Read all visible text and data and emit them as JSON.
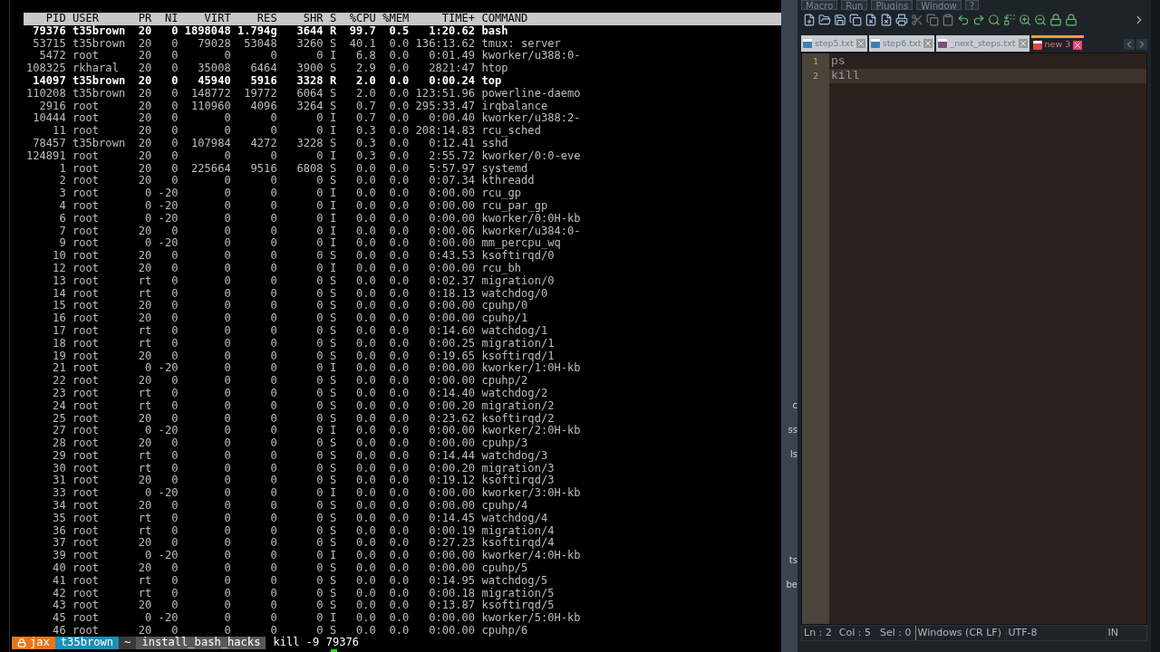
{
  "terminal": {
    "header": {
      "pid": "PID",
      "user": "USER",
      "pr": "PR",
      "ni": "NI",
      "virt": "VIRT",
      "res": "RES",
      "shr": "SHR",
      "s": "S",
      "cpu": "%CPU",
      "mem": "%MEM",
      "time": "TIME+",
      "command": "COMMAND"
    },
    "processes": [
      {
        "pid": "79376",
        "user": "t35brown",
        "pr": "20",
        "ni": "0",
        "virt": "1898048",
        "res": "1.794g",
        "shr": "3644",
        "s": "R",
        "cpu": "99.7",
        "mem": "0.5",
        "time": "1:20.62",
        "command": "bash",
        "bright": true
      },
      {
        "pid": "53715",
        "user": "t35brown",
        "pr": "20",
        "ni": "0",
        "virt": "79028",
        "res": "53048",
        "shr": "3260",
        "s": "S",
        "cpu": "40.1",
        "mem": "0.0",
        "time": "136:13.62",
        "command": "tmux: server",
        "bright": false
      },
      {
        "pid": "5472",
        "user": "root",
        "pr": "20",
        "ni": "0",
        "virt": "0",
        "res": "0",
        "shr": "0",
        "s": "I",
        "cpu": "6.8",
        "mem": "0.0",
        "time": "0:01.49",
        "command": "kworker/u388:0-",
        "bright": false
      },
      {
        "pid": "108325",
        "user": "rkharal",
        "pr": "20",
        "ni": "0",
        "virt": "35008",
        "res": "6464",
        "shr": "3900",
        "s": "S",
        "cpu": "2.9",
        "mem": "0.0",
        "time": "2821:47",
        "command": "htop",
        "bright": false
      },
      {
        "pid": "14097",
        "user": "t35brown",
        "pr": "20",
        "ni": "0",
        "virt": "45940",
        "res": "5916",
        "shr": "3328",
        "s": "R",
        "cpu": "2.0",
        "mem": "0.0",
        "time": "0:00.24",
        "command": "top",
        "bright": true
      },
      {
        "pid": "110208",
        "user": "t35brown",
        "pr": "20",
        "ni": "0",
        "virt": "148772",
        "res": "19772",
        "shr": "6064",
        "s": "S",
        "cpu": "2.0",
        "mem": "0.0",
        "time": "123:51.96",
        "command": "powerline-daemo",
        "bright": false
      },
      {
        "pid": "2916",
        "user": "root",
        "pr": "20",
        "ni": "0",
        "virt": "110960",
        "res": "4096",
        "shr": "3264",
        "s": "S",
        "cpu": "0.7",
        "mem": "0.0",
        "time": "295:33.47",
        "command": "irqbalance",
        "bright": false
      },
      {
        "pid": "10444",
        "user": "root",
        "pr": "20",
        "ni": "0",
        "virt": "0",
        "res": "0",
        "shr": "0",
        "s": "I",
        "cpu": "0.7",
        "mem": "0.0",
        "time": "0:00.40",
        "command": "kworker/u388:2-",
        "bright": false
      },
      {
        "pid": "11",
        "user": "root",
        "pr": "20",
        "ni": "0",
        "virt": "0",
        "res": "0",
        "shr": "0",
        "s": "I",
        "cpu": "0.3",
        "mem": "0.0",
        "time": "208:14.83",
        "command": "rcu_sched",
        "bright": false
      },
      {
        "pid": "78457",
        "user": "t35brown",
        "pr": "20",
        "ni": "0",
        "virt": "107984",
        "res": "4272",
        "shr": "3228",
        "s": "S",
        "cpu": "0.3",
        "mem": "0.0",
        "time": "0:12.41",
        "command": "sshd",
        "bright": false
      },
      {
        "pid": "124891",
        "user": "root",
        "pr": "20",
        "ni": "0",
        "virt": "0",
        "res": "0",
        "shr": "0",
        "s": "I",
        "cpu": "0.3",
        "mem": "0.0",
        "time": "2:55.72",
        "command": "kworker/0:0-eve",
        "bright": false
      },
      {
        "pid": "1",
        "user": "root",
        "pr": "20",
        "ni": "0",
        "virt": "225664",
        "res": "9516",
        "shr": "6808",
        "s": "S",
        "cpu": "0.0",
        "mem": "0.0",
        "time": "5:57.97",
        "command": "systemd",
        "bright": false
      },
      {
        "pid": "2",
        "user": "root",
        "pr": "20",
        "ni": "0",
        "virt": "0",
        "res": "0",
        "shr": "0",
        "s": "S",
        "cpu": "0.0",
        "mem": "0.0",
        "time": "0:07.34",
        "command": "kthreadd",
        "bright": false
      },
      {
        "pid": "3",
        "user": "root",
        "pr": "0",
        "ni": "-20",
        "virt": "0",
        "res": "0",
        "shr": "0",
        "s": "I",
        "cpu": "0.0",
        "mem": "0.0",
        "time": "0:00.00",
        "command": "rcu_gp",
        "bright": false
      },
      {
        "pid": "4",
        "user": "root",
        "pr": "0",
        "ni": "-20",
        "virt": "0",
        "res": "0",
        "shr": "0",
        "s": "I",
        "cpu": "0.0",
        "mem": "0.0",
        "time": "0:00.00",
        "command": "rcu_par_gp",
        "bright": false
      },
      {
        "pid": "6",
        "user": "root",
        "pr": "0",
        "ni": "-20",
        "virt": "0",
        "res": "0",
        "shr": "0",
        "s": "I",
        "cpu": "0.0",
        "mem": "0.0",
        "time": "0:00.00",
        "command": "kworker/0:0H-kb",
        "bright": false
      },
      {
        "pid": "7",
        "user": "root",
        "pr": "20",
        "ni": "0",
        "virt": "0",
        "res": "0",
        "shr": "0",
        "s": "I",
        "cpu": "0.0",
        "mem": "0.0",
        "time": "0:00.06",
        "command": "kworker/u384:0-",
        "bright": false
      },
      {
        "pid": "9",
        "user": "root",
        "pr": "0",
        "ni": "-20",
        "virt": "0",
        "res": "0",
        "shr": "0",
        "s": "I",
        "cpu": "0.0",
        "mem": "0.0",
        "time": "0:00.00",
        "command": "mm_percpu_wq",
        "bright": false
      },
      {
        "pid": "10",
        "user": "root",
        "pr": "20",
        "ni": "0",
        "virt": "0",
        "res": "0",
        "shr": "0",
        "s": "S",
        "cpu": "0.0",
        "mem": "0.0",
        "time": "0:43.53",
        "command": "ksoftirqd/0",
        "bright": false
      },
      {
        "pid": "12",
        "user": "root",
        "pr": "20",
        "ni": "0",
        "virt": "0",
        "res": "0",
        "shr": "0",
        "s": "I",
        "cpu": "0.0",
        "mem": "0.0",
        "time": "0:00.00",
        "command": "rcu_bh",
        "bright": false
      },
      {
        "pid": "13",
        "user": "root",
        "pr": "rt",
        "ni": "0",
        "virt": "0",
        "res": "0",
        "shr": "0",
        "s": "S",
        "cpu": "0.0",
        "mem": "0.0",
        "time": "0:02.37",
        "command": "migration/0",
        "bright": false
      },
      {
        "pid": "14",
        "user": "root",
        "pr": "rt",
        "ni": "0",
        "virt": "0",
        "res": "0",
        "shr": "0",
        "s": "S",
        "cpu": "0.0",
        "mem": "0.0",
        "time": "0:18.13",
        "command": "watchdog/0",
        "bright": false
      },
      {
        "pid": "15",
        "user": "root",
        "pr": "20",
        "ni": "0",
        "virt": "0",
        "res": "0",
        "shr": "0",
        "s": "S",
        "cpu": "0.0",
        "mem": "0.0",
        "time": "0:00.00",
        "command": "cpuhp/0",
        "bright": false
      },
      {
        "pid": "16",
        "user": "root",
        "pr": "20",
        "ni": "0",
        "virt": "0",
        "res": "0",
        "shr": "0",
        "s": "S",
        "cpu": "0.0",
        "mem": "0.0",
        "time": "0:00.00",
        "command": "cpuhp/1",
        "bright": false
      },
      {
        "pid": "17",
        "user": "root",
        "pr": "rt",
        "ni": "0",
        "virt": "0",
        "res": "0",
        "shr": "0",
        "s": "S",
        "cpu": "0.0",
        "mem": "0.0",
        "time": "0:14.60",
        "command": "watchdog/1",
        "bright": false
      },
      {
        "pid": "18",
        "user": "root",
        "pr": "rt",
        "ni": "0",
        "virt": "0",
        "res": "0",
        "shr": "0",
        "s": "S",
        "cpu": "0.0",
        "mem": "0.0",
        "time": "0:00.25",
        "command": "migration/1",
        "bright": false
      },
      {
        "pid": "19",
        "user": "root",
        "pr": "20",
        "ni": "0",
        "virt": "0",
        "res": "0",
        "shr": "0",
        "s": "S",
        "cpu": "0.0",
        "mem": "0.0",
        "time": "0:19.65",
        "command": "ksoftirqd/1",
        "bright": false
      },
      {
        "pid": "21",
        "user": "root",
        "pr": "0",
        "ni": "-20",
        "virt": "0",
        "res": "0",
        "shr": "0",
        "s": "I",
        "cpu": "0.0",
        "mem": "0.0",
        "time": "0:00.00",
        "command": "kworker/1:0H-kb",
        "bright": false
      },
      {
        "pid": "22",
        "user": "root",
        "pr": "20",
        "ni": "0",
        "virt": "0",
        "res": "0",
        "shr": "0",
        "s": "S",
        "cpu": "0.0",
        "mem": "0.0",
        "time": "0:00.00",
        "command": "cpuhp/2",
        "bright": false
      },
      {
        "pid": "23",
        "user": "root",
        "pr": "rt",
        "ni": "0",
        "virt": "0",
        "res": "0",
        "shr": "0",
        "s": "S",
        "cpu": "0.0",
        "mem": "0.0",
        "time": "0:14.40",
        "command": "watchdog/2",
        "bright": false
      },
      {
        "pid": "24",
        "user": "root",
        "pr": "rt",
        "ni": "0",
        "virt": "0",
        "res": "0",
        "shr": "0",
        "s": "S",
        "cpu": "0.0",
        "mem": "0.0",
        "time": "0:00.20",
        "command": "migration/2",
        "bright": false
      },
      {
        "pid": "25",
        "user": "root",
        "pr": "20",
        "ni": "0",
        "virt": "0",
        "res": "0",
        "shr": "0",
        "s": "S",
        "cpu": "0.0",
        "mem": "0.0",
        "time": "0:23.62",
        "command": "ksoftirqd/2",
        "bright": false
      },
      {
        "pid": "27",
        "user": "root",
        "pr": "0",
        "ni": "-20",
        "virt": "0",
        "res": "0",
        "shr": "0",
        "s": "I",
        "cpu": "0.0",
        "mem": "0.0",
        "time": "0:00.00",
        "command": "kworker/2:0H-kb",
        "bright": false
      },
      {
        "pid": "28",
        "user": "root",
        "pr": "20",
        "ni": "0",
        "virt": "0",
        "res": "0",
        "shr": "0",
        "s": "S",
        "cpu": "0.0",
        "mem": "0.0",
        "time": "0:00.00",
        "command": "cpuhp/3",
        "bright": false
      },
      {
        "pid": "29",
        "user": "root",
        "pr": "rt",
        "ni": "0",
        "virt": "0",
        "res": "0",
        "shr": "0",
        "s": "S",
        "cpu": "0.0",
        "mem": "0.0",
        "time": "0:14.44",
        "command": "watchdog/3",
        "bright": false
      },
      {
        "pid": "30",
        "user": "root",
        "pr": "rt",
        "ni": "0",
        "virt": "0",
        "res": "0",
        "shr": "0",
        "s": "S",
        "cpu": "0.0",
        "mem": "0.0",
        "time": "0:00.20",
        "command": "migration/3",
        "bright": false
      },
      {
        "pid": "31",
        "user": "root",
        "pr": "20",
        "ni": "0",
        "virt": "0",
        "res": "0",
        "shr": "0",
        "s": "S",
        "cpu": "0.0",
        "mem": "0.0",
        "time": "0:19.12",
        "command": "ksoftirqd/3",
        "bright": false
      },
      {
        "pid": "33",
        "user": "root",
        "pr": "0",
        "ni": "-20",
        "virt": "0",
        "res": "0",
        "shr": "0",
        "s": "I",
        "cpu": "0.0",
        "mem": "0.0",
        "time": "0:00.00",
        "command": "kworker/3:0H-kb",
        "bright": false
      },
      {
        "pid": "34",
        "user": "root",
        "pr": "20",
        "ni": "0",
        "virt": "0",
        "res": "0",
        "shr": "0",
        "s": "S",
        "cpu": "0.0",
        "mem": "0.0",
        "time": "0:00.00",
        "command": "cpuhp/4",
        "bright": false
      },
      {
        "pid": "35",
        "user": "root",
        "pr": "rt",
        "ni": "0",
        "virt": "0",
        "res": "0",
        "shr": "0",
        "s": "S",
        "cpu": "0.0",
        "mem": "0.0",
        "time": "0:14.45",
        "command": "watchdog/4",
        "bright": false
      },
      {
        "pid": "36",
        "user": "root",
        "pr": "rt",
        "ni": "0",
        "virt": "0",
        "res": "0",
        "shr": "0",
        "s": "S",
        "cpu": "0.0",
        "mem": "0.0",
        "time": "0:00.19",
        "command": "migration/4",
        "bright": false
      },
      {
        "pid": "37",
        "user": "root",
        "pr": "20",
        "ni": "0",
        "virt": "0",
        "res": "0",
        "shr": "0",
        "s": "S",
        "cpu": "0.0",
        "mem": "0.0",
        "time": "0:27.23",
        "command": "ksoftirqd/4",
        "bright": false
      },
      {
        "pid": "39",
        "user": "root",
        "pr": "0",
        "ni": "-20",
        "virt": "0",
        "res": "0",
        "shr": "0",
        "s": "I",
        "cpu": "0.0",
        "mem": "0.0",
        "time": "0:00.00",
        "command": "kworker/4:0H-kb",
        "bright": false
      },
      {
        "pid": "40",
        "user": "root",
        "pr": "20",
        "ni": "0",
        "virt": "0",
        "res": "0",
        "shr": "0",
        "s": "S",
        "cpu": "0.0",
        "mem": "0.0",
        "time": "0:00.00",
        "command": "cpuhp/5",
        "bright": false
      },
      {
        "pid": "41",
        "user": "root",
        "pr": "rt",
        "ni": "0",
        "virt": "0",
        "res": "0",
        "shr": "0",
        "s": "S",
        "cpu": "0.0",
        "mem": "0.0",
        "time": "0:14.95",
        "command": "watchdog/5",
        "bright": false
      },
      {
        "pid": "42",
        "user": "root",
        "pr": "rt",
        "ni": "0",
        "virt": "0",
        "res": "0",
        "shr": "0",
        "s": "S",
        "cpu": "0.0",
        "mem": "0.0",
        "time": "0:00.18",
        "command": "migration/5",
        "bright": false
      },
      {
        "pid": "43",
        "user": "root",
        "pr": "20",
        "ni": "0",
        "virt": "0",
        "res": "0",
        "shr": "0",
        "s": "S",
        "cpu": "0.0",
        "mem": "0.0",
        "time": "0:13.87",
        "command": "ksoftirqd/5",
        "bright": false
      },
      {
        "pid": "45",
        "user": "root",
        "pr": "0",
        "ni": "-20",
        "virt": "0",
        "res": "0",
        "shr": "0",
        "s": "I",
        "cpu": "0.0",
        "mem": "0.0",
        "time": "0:00.00",
        "command": "kworker/5:0H-kb",
        "bright": false
      },
      {
        "pid": "46",
        "user": "root",
        "pr": "20",
        "ni": "0",
        "virt": "0",
        "res": "0",
        "shr": "0",
        "s": "S",
        "cpu": "0.0",
        "mem": "0.0",
        "time": "0:00.00",
        "command": "cpuhp/6",
        "bright": false
      }
    ],
    "prompt": {
      "segments": [
        {
          "text": "jax",
          "color": "#e8761a"
        },
        {
          "text": "t35brown",
          "color": "#1c8fb8"
        },
        {
          "text": "~",
          "color": "#3a3a3a"
        },
        {
          "text": "install_bash_hacks",
          "color": "#585858"
        }
      ],
      "command": "kill -9 79376"
    }
  },
  "background_window": {
    "fragments": [
      "c",
      "ss",
      "ls",
      "ts",
      "be"
    ]
  },
  "editor": {
    "menu": [
      "Macro",
      "Run",
      "Plugins",
      "Window",
      "?"
    ],
    "tabs": [
      {
        "label": "step5.txt",
        "selected": false,
        "color": "#3f7fb8"
      },
      {
        "label": "step6.txt",
        "selected": false,
        "color": "#3f7fb8"
      },
      {
        "label": "_next_steps.txt",
        "selected": false,
        "color": "#7a4f7a"
      },
      {
        "label": "new 3",
        "selected": true,
        "color": "#e04848"
      }
    ],
    "lines": [
      {
        "number": "1",
        "text": "ps",
        "current": false
      },
      {
        "number": "2",
        "text": "kill",
        "current": true
      }
    ],
    "status": {
      "line": "Ln : 2",
      "col": "Col : 5",
      "sel": "Sel : 0",
      "eol": "Windows (CR LF)",
      "encoding": "UTF-8",
      "mode": "IN"
    }
  }
}
